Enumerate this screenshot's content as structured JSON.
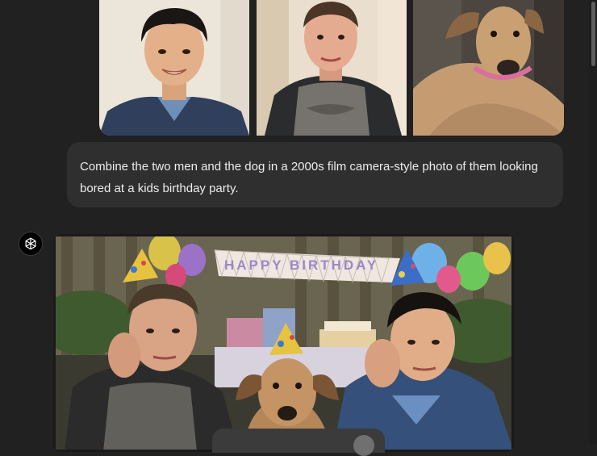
{
  "uploads": {
    "images": [
      {
        "subject": "man-portrait-1"
      },
      {
        "subject": "man-portrait-2"
      },
      {
        "subject": "dog-portrait"
      }
    ]
  },
  "user_message": {
    "text": "Combine the two men and the dog in a 2000s film camera-style photo of them looking bored at a kids birthday party."
  },
  "assistant": {
    "icon": "openai-logo-icon",
    "generated_image": {
      "banner_text": "HAPPY BIRTHDAY"
    }
  },
  "colors": {
    "background": "#212121",
    "bubble": "#2f2f2f",
    "text": "#ececec"
  }
}
